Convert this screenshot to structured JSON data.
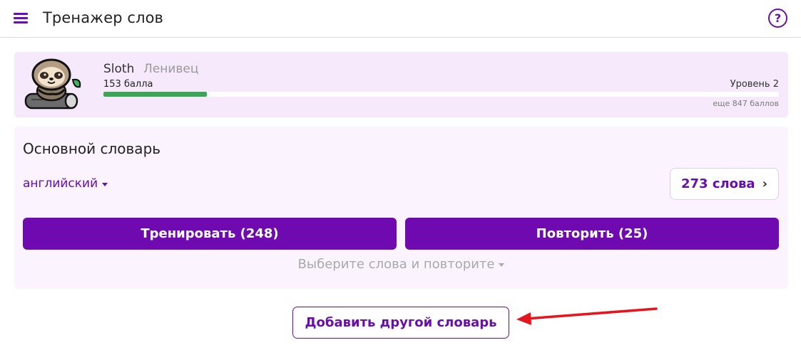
{
  "header": {
    "title": "Тренажер слов",
    "help_label": "?"
  },
  "profile": {
    "mascot_name": "Sloth",
    "mascot_name_ru": "Ленивец",
    "points": "153 балла",
    "level": "Уровень 2",
    "remaining": "еще 847 баллов",
    "progress_fraction": 0.153
  },
  "dictionary": {
    "title": "Основной словарь",
    "language": "английский",
    "words_count": "273 слова",
    "train_label": "Тренировать (248)",
    "repeat_label": "Повторить (25)",
    "select_repeat_label": "Выберите слова и повторите"
  },
  "add_dictionary_label": "Добавить другой словарь",
  "colors": {
    "accent": "#6e0ab0",
    "progress": "#3aa655",
    "profile_bg": "#f6e9fb",
    "card_bg": "#fbf3fd",
    "annotation_arrow": "#e8141c"
  },
  "icons": {
    "menu": "menu-icon",
    "help": "help-circle-icon",
    "avatar": "sloth-mascot",
    "words_chevron": "chevron-right-icon",
    "language_caret": "caret-down-icon"
  }
}
